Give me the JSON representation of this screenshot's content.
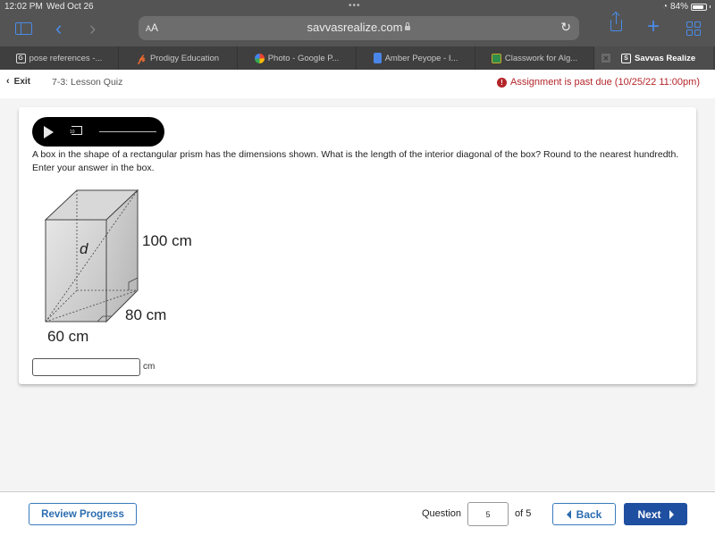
{
  "status_bar": {
    "time": "12:02 PM",
    "date": "Wed Oct 26",
    "battery_percent_label": "84%",
    "battery_level": 0.84
  },
  "toolbar": {
    "text_size_label": "AA",
    "url": "savvasrealize.com",
    "icons": [
      "sidebar-icon",
      "back-icon",
      "forward-icon",
      "lock-icon",
      "reload-icon",
      "share-icon",
      "new-tab-icon",
      "tab-overview-icon"
    ]
  },
  "tabs": [
    {
      "label": "pose references -...",
      "favicon": "G"
    },
    {
      "label": "Prodigy Education",
      "favicon": "P"
    },
    {
      "label": "Photo - Google P...",
      "favicon": "photos"
    },
    {
      "label": "Amber Peyope - I...",
      "favicon": "docs"
    },
    {
      "label": "Classwork for Alg...",
      "favicon": "classroom"
    },
    {
      "label": "Savvas Realize",
      "favicon": "S",
      "active": true
    }
  ],
  "header": {
    "exit_label": "Exit",
    "lesson_title": "7-3: Lesson Quiz",
    "past_due_message": "Assignment is past due (10/25/22 11:00pm)",
    "alert_glyph": "!"
  },
  "question": {
    "audio_rewind_seconds": "10",
    "text": "A box in the shape of a rectangular prism has the dimensions shown. What is the length of the interior diagonal of the box? Round to the nearest hundredth. Enter your answer in the box.",
    "figure": {
      "diagonal_label": "d",
      "height_label": "100 cm",
      "depth_label": "80 cm",
      "width_label": "60 cm"
    },
    "answer_value": "",
    "answer_unit": "cm"
  },
  "footer": {
    "review_label": "Review Progress",
    "question_label": "Question",
    "current_question": "5",
    "of_label": "of 5",
    "back_label": "Back",
    "next_label": "Next"
  }
}
